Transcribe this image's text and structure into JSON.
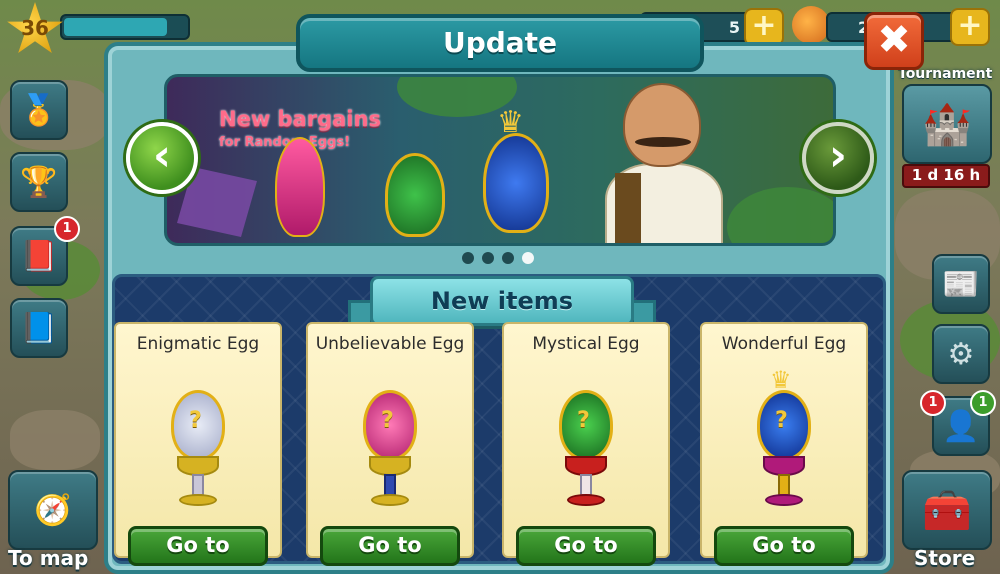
{
  "hud": {
    "level": "36",
    "resource_1_value": "5",
    "resource_2_value": "2   K"
  },
  "dialog": {
    "title": "Update",
    "close_label": "✖"
  },
  "banner": {
    "headline": "New bargains",
    "subline": "for Random Eggs!",
    "prev_label": "‹",
    "next_label": "›",
    "page_count": 4,
    "active_page": 4
  },
  "section": {
    "title": "New items"
  },
  "items": [
    {
      "name": "Enigmatic Egg",
      "button": "Go to"
    },
    {
      "name": "Unbelievable Egg",
      "button": "Go to"
    },
    {
      "name": "Mystical Egg",
      "button": "Go to"
    },
    {
      "name": "Wonderful Egg",
      "button": "Go to"
    }
  ],
  "sidebar_left": {
    "map_label": "To map",
    "guide_badge": "1"
  },
  "sidebar_right": {
    "tournament_label": "Tournament",
    "tournament_timer": "1 d 16 h",
    "store_label": "Store",
    "friends_badge_red": "1",
    "friends_badge_green": "1"
  },
  "colors": {
    "panel": "#6fb7bd",
    "title_bar": "#157681",
    "go_button": "#2f8a24",
    "close_button": "#e0521f",
    "banner_headline": "#ff6b8a"
  }
}
